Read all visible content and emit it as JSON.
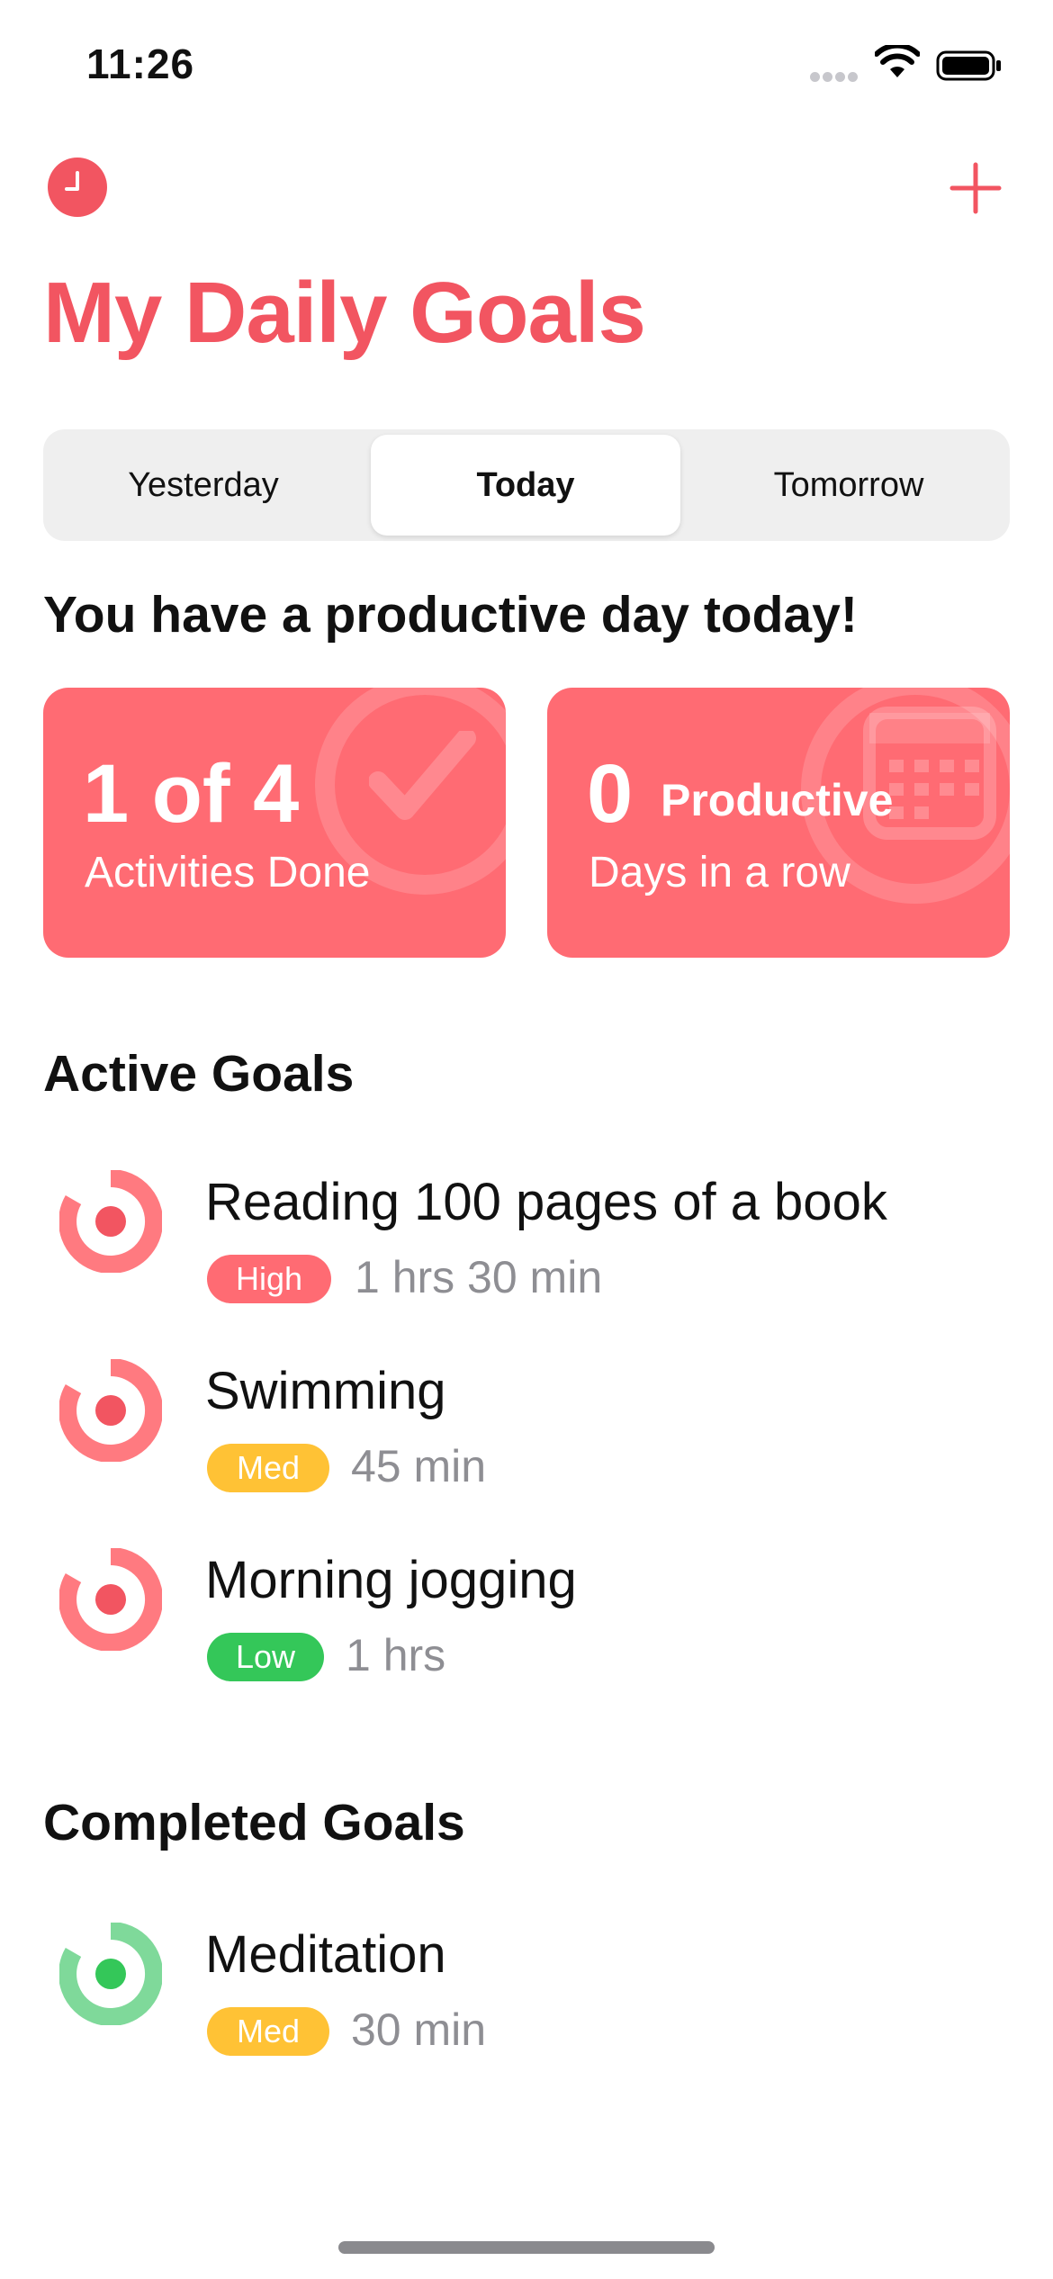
{
  "status_bar": {
    "time": "11:26",
    "icons": [
      "cellular-signal-icon",
      "wifi-icon",
      "battery-icon"
    ]
  },
  "header": {
    "title": "My Daily Goals",
    "left_icon": "clock-icon",
    "right_icon": "plus-icon"
  },
  "segments": {
    "items": [
      "Yesterday",
      "Today",
      "Tomorrow"
    ],
    "selected": "Today"
  },
  "headline": "You have a productive day today!",
  "stats": {
    "activities": {
      "value": "1 of 4",
      "label": "Activities Done",
      "icon": "checkmark-icon"
    },
    "streak": {
      "value": "0",
      "value_suffix": "Productive",
      "label": "Days in a row",
      "icon": "calendar-icon"
    }
  },
  "active_goals": {
    "title": "Active Goals",
    "items": [
      {
        "title": "Reading 100 pages of a book",
        "priority": "High",
        "duration": "1 hrs 30 min"
      },
      {
        "title": "Swimming",
        "priority": "Med",
        "duration": "45 min"
      },
      {
        "title": "Morning jogging",
        "priority": "Low",
        "duration": "1 hrs"
      }
    ]
  },
  "completed_goals": {
    "title": "Completed Goals",
    "items": [
      {
        "title": "Meditation",
        "priority": "Med",
        "duration": "30 min"
      }
    ]
  },
  "colors": {
    "accent": "#f25561",
    "card": "#ff6b73",
    "high": "#ff6b73",
    "med": "#ffc235",
    "low": "#34c759",
    "completed": "#34c759",
    "segment_bg": "#efefef",
    "muted_text": "#8e8e93"
  }
}
